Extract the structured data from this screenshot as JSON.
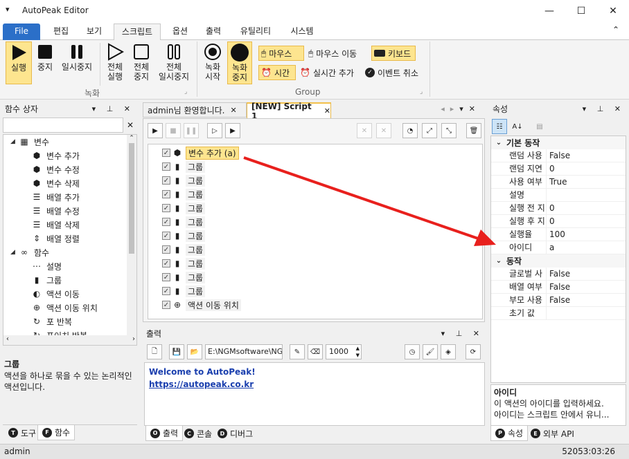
{
  "window": {
    "title": "AutoPeak Editor",
    "menu_glyph": "▾",
    "minimize": "—",
    "maximize": "☐",
    "close": "✕"
  },
  "ribbon_tabs": [
    "File",
    "편집",
    "보기",
    "스크립트",
    "옵션",
    "출력",
    "유틸리티",
    "시스템"
  ],
  "ribbon_collapse": "⌃",
  "ribbon": {
    "run": "실행",
    "stop": "중지",
    "pause": "일시중지",
    "run_all": "전체\n실행",
    "stop_all": "전체\n중지",
    "pause_all": "전체\n일시중지",
    "group1_label": "녹화",
    "rec_start": "녹화\n시작",
    "rec_stop": "녹화\n중지",
    "mouse": "마우스",
    "mouse_move": "마우스 이동",
    "keyboard": "키보드",
    "time": "시간",
    "realtime_add": "실시간 추가",
    "event_cancel": "이벤트 취소",
    "group2_label": "Group",
    "corner": "⌟"
  },
  "left_panel": {
    "title": "함수 상자",
    "search_clear": "✕",
    "tree": [
      {
        "level": 0,
        "label": "변수",
        "icon": "grid-icon",
        "toggle": "◢"
      },
      {
        "level": 1,
        "label": "변수 추가",
        "icon": "cube-icon"
      },
      {
        "level": 1,
        "label": "변수 수정",
        "icon": "cube-icon"
      },
      {
        "level": 1,
        "label": "변수 삭제",
        "icon": "cube-icon"
      },
      {
        "level": 1,
        "label": "배열 추가",
        "icon": "list-icon"
      },
      {
        "level": 1,
        "label": "배열 수정",
        "icon": "list-icon"
      },
      {
        "level": 1,
        "label": "배열 삭제",
        "icon": "list-icon"
      },
      {
        "level": 1,
        "label": "배열 정렬",
        "icon": "sort-icon"
      },
      {
        "level": 0,
        "label": "함수",
        "icon": "infinity-icon",
        "toggle": "◢"
      },
      {
        "level": 1,
        "label": "설명",
        "icon": "dots-icon"
      },
      {
        "level": 1,
        "label": "그룹",
        "icon": "group-icon"
      },
      {
        "level": 1,
        "label": "액션 이동",
        "icon": "c-icon"
      },
      {
        "level": 1,
        "label": "액션 이동 위치",
        "icon": "target-icon"
      },
      {
        "level": 1,
        "label": "포 반복",
        "icon": "loop-icon"
      },
      {
        "level": 1,
        "label": "포이치 반복",
        "icon": "loop-icon"
      }
    ],
    "desc_title": "그룹",
    "desc_text": "액션을 하나로 묶을 수 있는 논리적인 액션입니다.",
    "tabs": [
      {
        "key": "T",
        "label": "도구"
      },
      {
        "key": "F",
        "label": "함수"
      }
    ]
  },
  "doc_tabs": [
    {
      "label": "admin님 환영합니다."
    },
    {
      "label": "[NEW] Script 1"
    }
  ],
  "script": {
    "rows": [
      {
        "label": "변수 추가 (a)",
        "icon": "cube-icon"
      },
      {
        "label": "그룹",
        "icon": "group-icon"
      },
      {
        "label": "그룹",
        "icon": "group-icon"
      },
      {
        "label": "그룹",
        "icon": "group-icon"
      },
      {
        "label": "그룹",
        "icon": "group-icon"
      },
      {
        "label": "그룹",
        "icon": "group-icon"
      },
      {
        "label": "그룹",
        "icon": "group-icon"
      },
      {
        "label": "그룹",
        "icon": "group-icon"
      },
      {
        "label": "그룹",
        "icon": "group-icon"
      },
      {
        "label": "그룹",
        "icon": "group-icon"
      },
      {
        "label": "그룹",
        "icon": "group-icon"
      },
      {
        "label": "액션 이동 위치",
        "icon": "target-icon"
      }
    ]
  },
  "output": {
    "title": "출력",
    "path": "E:\\NGMsoftware\\NG",
    "limit": "1000",
    "welcome": "Welcome to AutoPeak!",
    "link": "https://autopeak.co.kr",
    "tabs": [
      {
        "key": "O",
        "label": "출력"
      },
      {
        "key": "C",
        "label": "콘솔"
      },
      {
        "key": "D",
        "label": "디버그"
      }
    ]
  },
  "props": {
    "title": "속성",
    "categories": [
      {
        "name": "기본 동작",
        "rows": [
          {
            "k": "랜덤 사용",
            "v": "False"
          },
          {
            "k": "랜덤 지연",
            "v": "0"
          },
          {
            "k": "사용 여부",
            "v": "True"
          },
          {
            "k": "설명",
            "v": ""
          },
          {
            "k": "실행 전 지",
            "v": "0"
          },
          {
            "k": "실행 후 지",
            "v": "0"
          },
          {
            "k": "실행율",
            "v": "100"
          },
          {
            "k": "아이디",
            "v": "a"
          }
        ]
      },
      {
        "name": "동작",
        "rows": [
          {
            "k": "글로벌 사",
            "v": "False"
          },
          {
            "k": "배열 여부",
            "v": "False"
          },
          {
            "k": "부모 사용",
            "v": "False"
          },
          {
            "k": "초기 값",
            "v": ""
          }
        ]
      }
    ],
    "desc_title": "아이디",
    "desc_line1": "이 액션의 아이디를 입력하세요.",
    "desc_line2": "아이디는 스크립트 안에서 유니...",
    "tabs": [
      {
        "key": "P",
        "label": "속성"
      },
      {
        "key": "E",
        "label": "외부 API"
      }
    ]
  },
  "status": {
    "user": "admin",
    "time": "52053:03:26"
  },
  "colors": {
    "accent": "#2b6fc8",
    "highlight": "#fde58f",
    "arrow": "#e8201d",
    "link": "#1a3fae"
  }
}
